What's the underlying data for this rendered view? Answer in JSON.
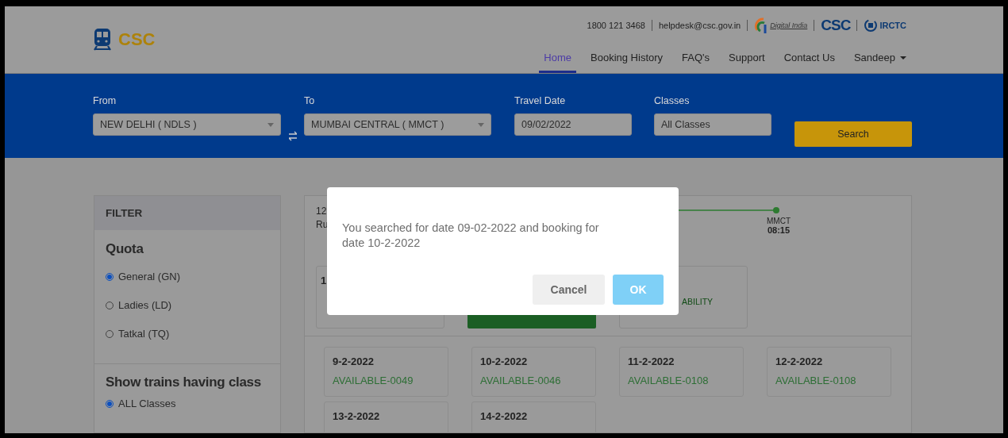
{
  "header": {
    "logo_text": "CSC",
    "phone": "1800 121 3468",
    "email": "helpdesk@csc.gov.in",
    "partners": [
      "Digital India",
      "CSC",
      "IRCTC"
    ],
    "nav": [
      {
        "label": "Home",
        "selected": true
      },
      {
        "label": "Booking History",
        "selected": false
      },
      {
        "label": "FAQ's",
        "selected": false
      },
      {
        "label": "Support",
        "selected": false
      },
      {
        "label": "Contact Us",
        "selected": false
      }
    ],
    "user_menu": "Sandeep"
  },
  "search": {
    "from": {
      "label": "From",
      "value": "NEW DELHI ( NDLS )"
    },
    "to": {
      "label": "To",
      "value": "MUMBAI CENTRAL ( MMCT )"
    },
    "travel_date": {
      "label": "Travel Date",
      "value": "09/02/2022"
    },
    "classes": {
      "label": "Classes",
      "value": "All Classes"
    },
    "button": "Search"
  },
  "filter": {
    "title": "FILTER",
    "quota": {
      "title": "Quota",
      "options": [
        {
          "label": "General (GN)",
          "selected": true
        },
        {
          "label": "Ladies (LD)",
          "selected": false
        },
        {
          "label": "Tatkal (TQ)",
          "selected": false
        }
      ]
    },
    "class_filter": {
      "title": "Show trains having class",
      "options": [
        {
          "label": "ALL Classes",
          "selected": true
        }
      ]
    }
  },
  "train_card": {
    "number_fragment": "12",
    "runs_fragment": "Ru",
    "destination": "MMCT",
    "arrival": "08:15",
    "class_fragment": "1",
    "availability_fragment": "ABILITY",
    "dates": [
      {
        "date": "9-2-2022",
        "status": "AVAILABLE-0049"
      },
      {
        "date": "10-2-2022",
        "status": "AVAILABLE-0046"
      },
      {
        "date": "11-2-2022",
        "status": "AVAILABLE-0108"
      },
      {
        "date": "12-2-2022",
        "status": "AVAILABLE-0108"
      },
      {
        "date": "13-2-2022"
      },
      {
        "date": "14-2-2022"
      }
    ]
  },
  "dialog": {
    "message": "You searched for date 09-02-2022 and booking for date 10-2-2022",
    "cancel": "Cancel",
    "ok": "OK"
  }
}
